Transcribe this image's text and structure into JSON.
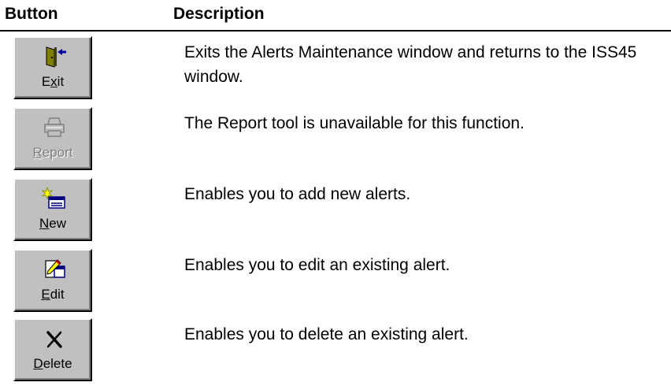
{
  "header": {
    "button_col": "Button",
    "description_col": "Description"
  },
  "rows": [
    {
      "button": {
        "label_pre": "E",
        "label_ul": "x",
        "label_post": "it",
        "icon": "exit-door-icon",
        "enabled": true
      },
      "description": "Exits the Alerts Maintenance window and returns to the ISS45 window."
    },
    {
      "button": {
        "label_pre": "",
        "label_ul": "R",
        "label_post": "eport",
        "icon": "printer-icon",
        "enabled": false
      },
      "description": "The Report tool is unavailable for this function."
    },
    {
      "button": {
        "label_pre": "",
        "label_ul": "N",
        "label_post": "ew",
        "icon": "new-document-icon",
        "enabled": true
      },
      "description": "Enables you to add new alerts."
    },
    {
      "button": {
        "label_pre": "",
        "label_ul": "E",
        "label_post": "dit",
        "icon": "edit-pencil-icon",
        "enabled": true
      },
      "description": "Enables you to edit an existing alert."
    },
    {
      "button": {
        "label_pre": "",
        "label_ul": "D",
        "label_post": "elete",
        "icon": "delete-x-icon",
        "enabled": true
      },
      "description": "Enables you to delete an existing alert."
    }
  ]
}
